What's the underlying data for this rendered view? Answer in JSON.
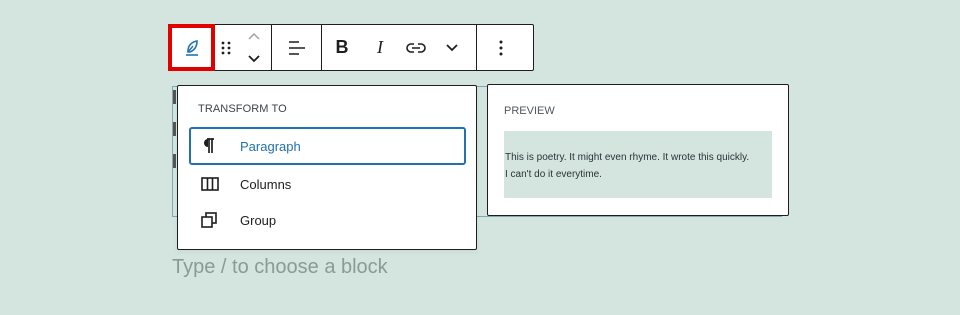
{
  "toolbar": {
    "block_type_icon": "feather-icon",
    "bold_label": "B",
    "italic_label": "I",
    "accent_color": "#e10000"
  },
  "transform_panel": {
    "title": "TRANSFORM TO",
    "items": [
      {
        "label": "Paragraph",
        "icon": "paragraph-icon",
        "active": true
      },
      {
        "label": "Columns",
        "icon": "columns-icon",
        "active": false
      },
      {
        "label": "Group",
        "icon": "group-icon",
        "active": false
      }
    ],
    "active_color": "#2271b1"
  },
  "preview_panel": {
    "title": "PREVIEW",
    "lines": [
      "This is poetry. It might even rhyme. It wrote this quickly.",
      "I can't do it everytime."
    ]
  },
  "editor": {
    "placeholder": "Type / to choose a block"
  }
}
